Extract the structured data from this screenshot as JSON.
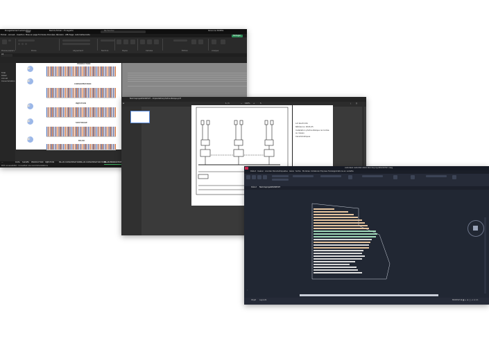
{
  "excel": {
    "app_name": "Enregistrement automatique",
    "doc_title": "Nomdu fichier • Enregistré",
    "search_placeholder": "Rechercher",
    "user": "Personne NOMSS",
    "menu": [
      "Fichier",
      "Accueil",
      "Insertion",
      "Mise en page",
      "Formules",
      "Données",
      "Révision",
      "Affichage",
      "Automatiser",
      "Aide"
    ],
    "share_label": "Partager",
    "ribbon_groups": [
      "Presse-papiers",
      "Police",
      "Alignement",
      "Nombre",
      "Styles",
      "Cellules",
      "Édition",
      "Analyse"
    ],
    "name_box": "A1",
    "left_labels": [
      "Total",
      "Détail",
      "Annuel",
      "Consommation"
    ],
    "chart_titles": [
      "PRODUCTION",
      "CONSOMMATION",
      "INJECTION",
      "SOUTIRAGE",
      "BILAN"
    ],
    "sheet_tabs": [
      "...",
      "DATA",
      "SAISIES",
      "PRODUCTION",
      "INJECTION",
      "BILAN CONSOMMATION",
      "BILAN CONSOMMATION MOIS",
      "BILAN PRODUCTION"
    ],
    "status_text": "Prêt   Accessibilité : Consultez nos recommandations"
  },
  "pdf": {
    "file_title": "Nomduprojet20240507 - Implantationphotovoltaique.pdf",
    "page_counter": "1 / 1",
    "zoom": "100%",
    "notes": [
      "Lot électricité",
      "Référence: 2024-05",
      "Installation photovoltaïque raccordée",
      "au réseau",
      "Caractéristiques"
    ]
  },
  "cad": {
    "window_title": "Autodesk AutoCAD 2024   Nomduprojet20240507.dwg",
    "menu": [
      "Début",
      "Insérer",
      "Annoter",
      "Paramétrique",
      "Vue",
      "Gérer",
      "Sortie",
      "Modules",
      "Collaborer",
      "Express Tools",
      "Applications en vedette"
    ],
    "tabs": [
      "Début",
      "Nomduprojet20240507"
    ],
    "layout_tabs": [
      "Objet",
      "Layout1"
    ],
    "status_right": "MODELE   ⊞ ▦ ⊾ ⊕ ◯ ∠ ⧈ 1:1"
  },
  "colors": {
    "excel_bg": "#1f1f1f",
    "excel_accent": "#3fae60",
    "pdf_bg": "#3a3a3a",
    "cad_bg": "#212733",
    "cad_accent": "#c7254e"
  }
}
